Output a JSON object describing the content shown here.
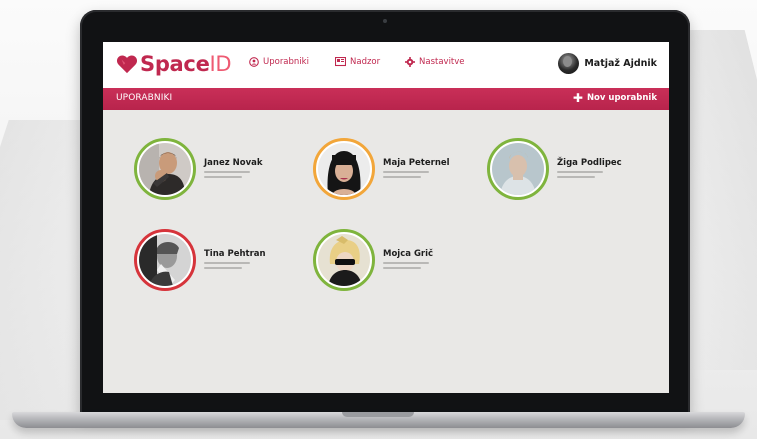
{
  "brand": {
    "name_main": "Space",
    "name_accent": "ID",
    "color": "#c0284f",
    "accent_color": "#ee5a72"
  },
  "nav": {
    "items": [
      {
        "label": "Uporabniki",
        "icon": "user-icon"
      },
      {
        "label": "Nadzor",
        "icon": "monitor-icon"
      },
      {
        "label": "Nastavitve",
        "icon": "gear-icon"
      }
    ]
  },
  "current_user": {
    "name": "Matjaž Ajdnik"
  },
  "section": {
    "title": "UPORABNIKI",
    "new_user_label": "Nov uporabnik",
    "bar_color": "#c0284f"
  },
  "users": [
    {
      "name": "Janez Novak",
      "status_color": "#7fb43d"
    },
    {
      "name": "Maja Peternel",
      "status_color": "#f2a63a"
    },
    {
      "name": "Žiga Podlipec",
      "status_color": "#7fb43d"
    },
    {
      "name": "Tina Pehtran",
      "status_color": "#d6343b"
    },
    {
      "name": "Mojca Grič",
      "status_color": "#7fb43d"
    }
  ]
}
